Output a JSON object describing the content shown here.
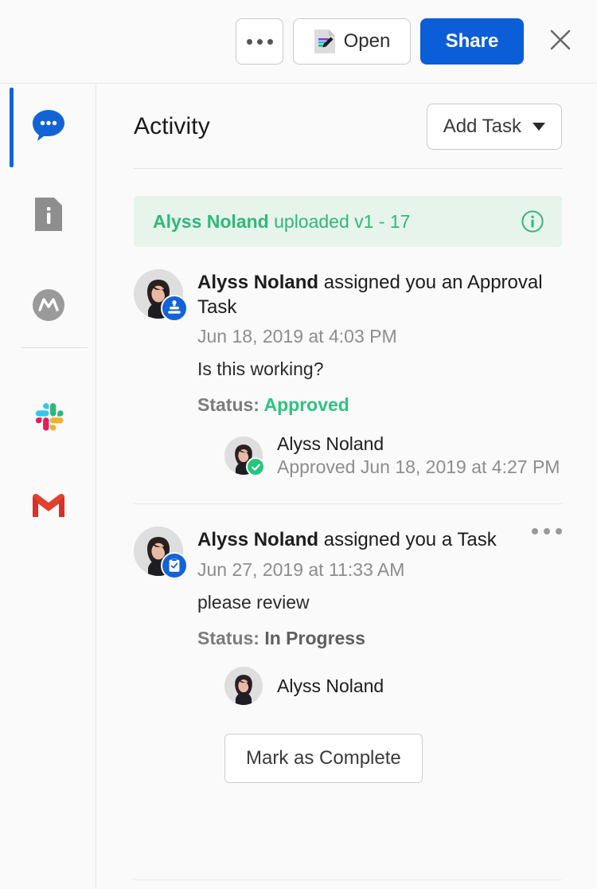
{
  "topbar": {
    "more_button": {
      "name": "more-options",
      "label": ""
    },
    "open_button": {
      "label": "Open",
      "icon": "document-edit-icon"
    },
    "share_button": {
      "label": "Share"
    },
    "close_button": {
      "icon": "close-icon"
    }
  },
  "sidebar": {
    "items": [
      {
        "name": "comments",
        "icon": "comment-bubble-icon",
        "active": true
      },
      {
        "name": "details",
        "icon": "document-info-icon",
        "active": false
      },
      {
        "name": "markup",
        "icon": "markup-avatar-icon",
        "active": false
      },
      {
        "name": "slack",
        "icon": "slack-icon",
        "active": false
      },
      {
        "name": "gmail",
        "icon": "gmail-icon",
        "active": false
      }
    ]
  },
  "panel": {
    "title": "Activity",
    "add_task_button": {
      "label": "Add Task",
      "icon": "chevron-down-icon"
    },
    "banner": {
      "user": "Alyss Noland",
      "action": " uploaded v1 - 17",
      "icon": "info-circle-icon",
      "bg_color": "#e7f4ec",
      "text_color": "#30b878"
    },
    "entries": [
      {
        "user": "Alyss Noland",
        "action": " assigned you an Approval Task",
        "badge_icon": "approval-stamp-icon",
        "timestamp": "Jun 18, 2019 at 4:03 PM",
        "note": "Is this working?",
        "status_label": "Status: ",
        "status_value": "Approved",
        "status_color": "#2bc47e",
        "has_kebab": false,
        "assignees": [
          {
            "name": "Alyss Noland",
            "sub": "Approved Jun 18, 2019 at 4:27 PM",
            "badge_icon": "check-circle-icon"
          }
        ],
        "action_button": null
      },
      {
        "user": "Alyss Noland",
        "action": " assigned you a Task",
        "badge_icon": "clipboard-task-icon",
        "timestamp": "Jun 27, 2019 at 11:33 AM",
        "note": "please review",
        "status_label": "Status: ",
        "status_value": "In Progress",
        "status_color": "#5e5e5e",
        "has_kebab": true,
        "kebab_icon": "kebab-menu-icon",
        "assignees": [
          {
            "name": "Alyss Noland",
            "sub": "",
            "badge_icon": ""
          }
        ],
        "action_button": {
          "label": "Mark as Complete"
        }
      }
    ]
  },
  "colors": {
    "accent_blue": "#0b5ed7",
    "rail_active": "#1264d6",
    "green": "#2bc47e",
    "page_bg": "#fafafa"
  }
}
